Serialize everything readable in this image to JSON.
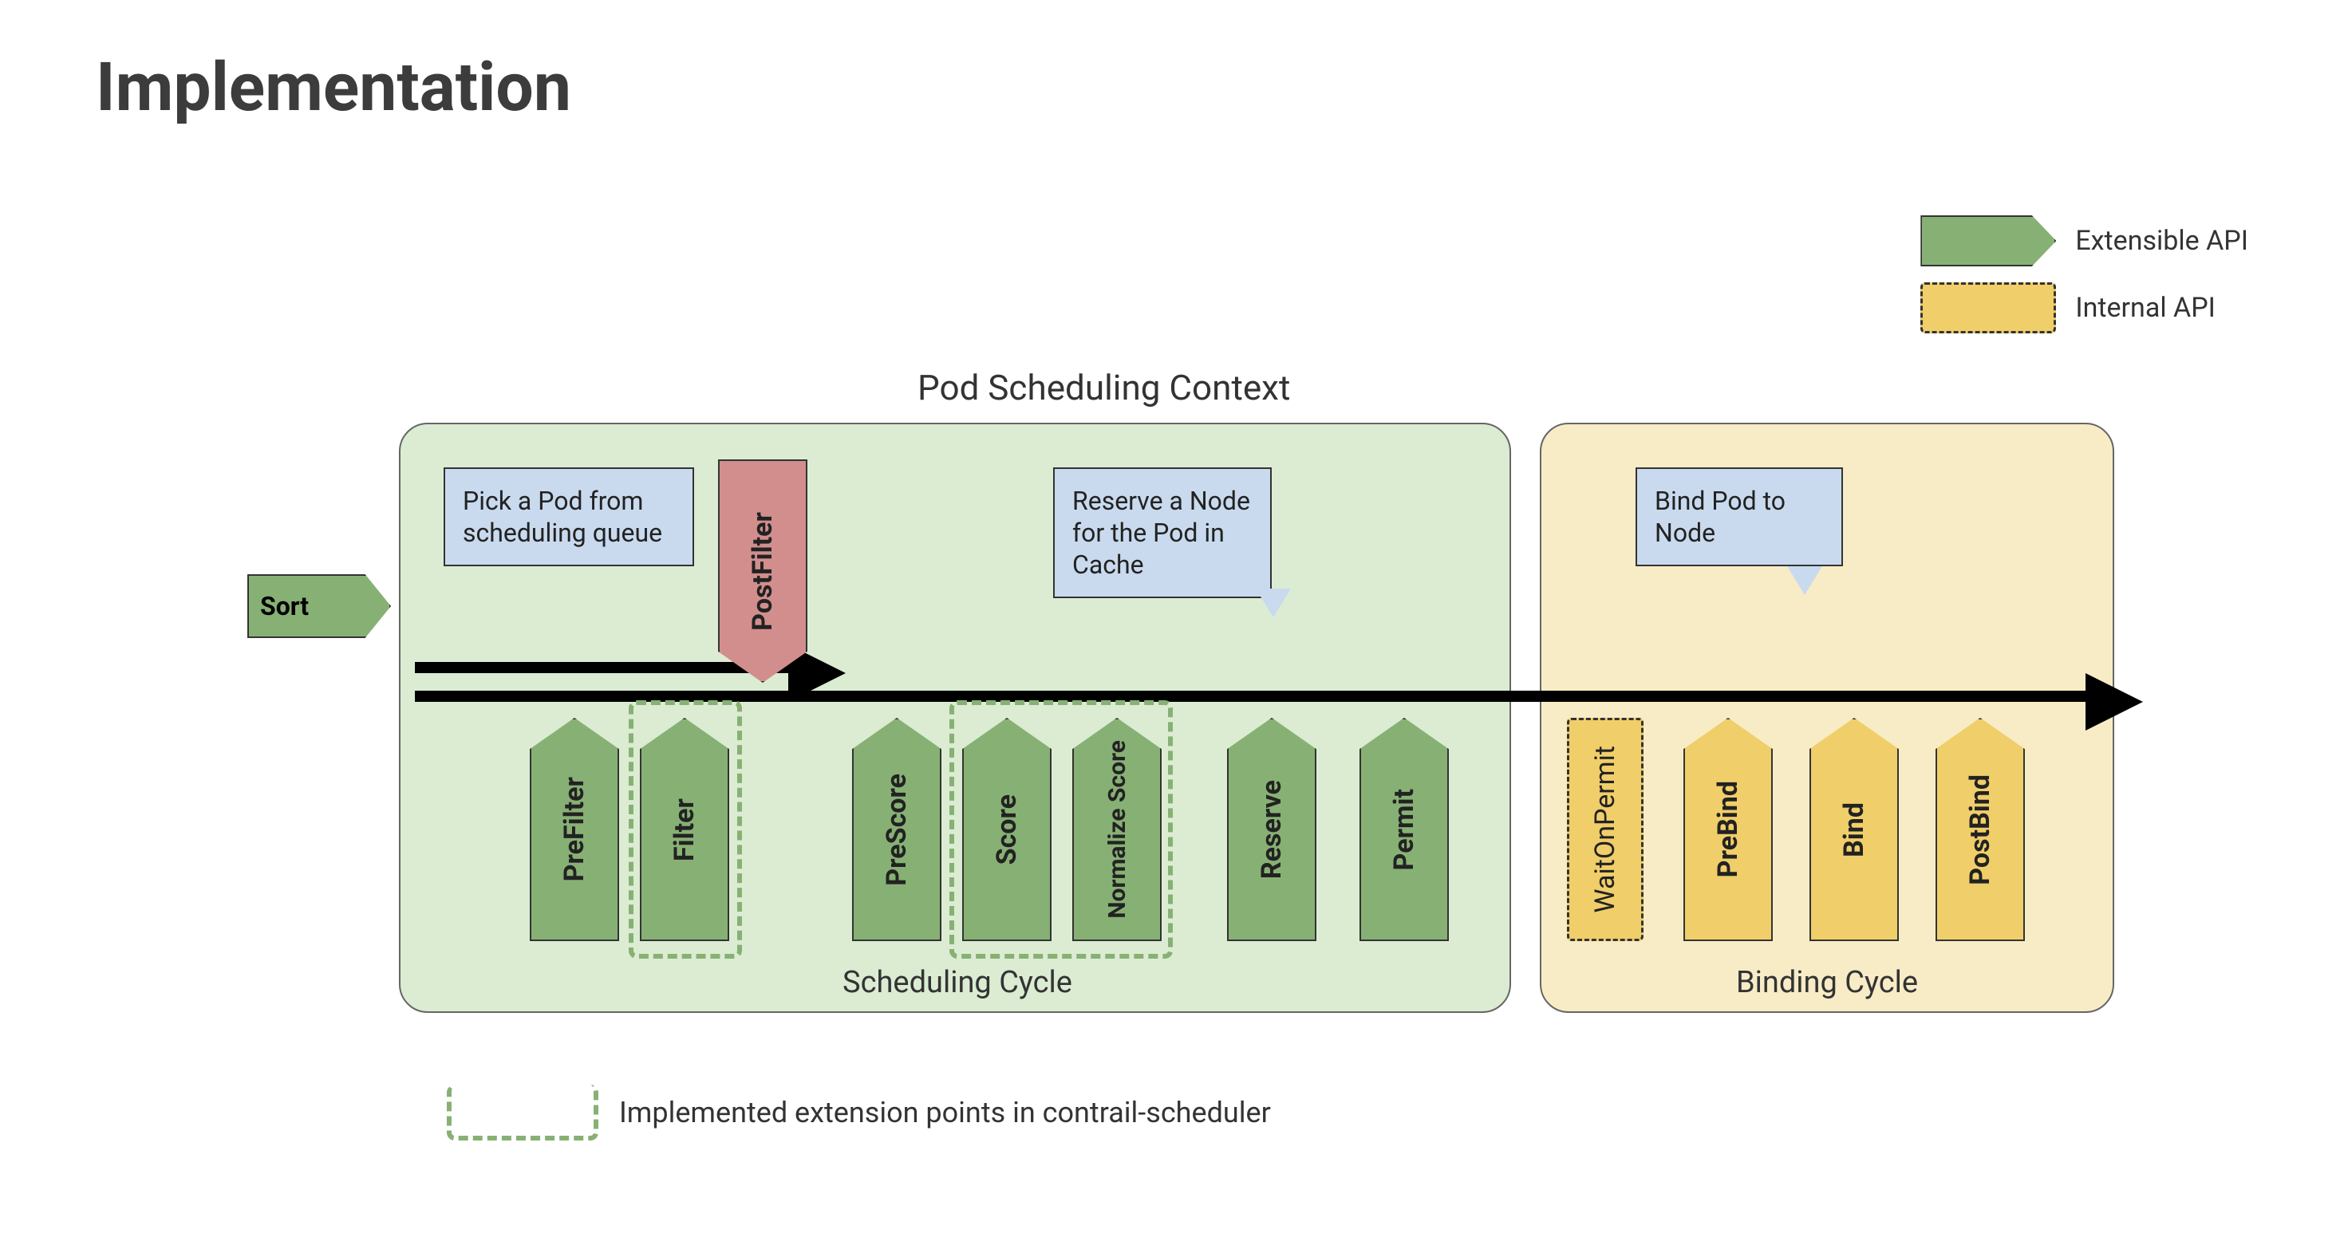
{
  "title": "Implementation",
  "legend": {
    "extensible": "Extensible API",
    "internal": "Internal API"
  },
  "context_title": "Pod Scheduling Context",
  "cycles": {
    "scheduling": "Scheduling Cycle",
    "binding": "Binding Cycle"
  },
  "sort_label": "Sort",
  "callouts": {
    "pick": "Pick a Pod from scheduling queue",
    "reserve": "Reserve a Node for the Pod in Cache",
    "bind": "Bind Pod to Node"
  },
  "extensions": {
    "post_filter": "PostFilter",
    "pre_filter": "PreFilter",
    "filter": "Filter",
    "pre_score": "PreScore",
    "score": "Score",
    "normalize_score": "Normalize Score",
    "reserve": "Reserve",
    "permit": "Permit",
    "wait_on_permit": "WaitOnPermit",
    "pre_bind": "PreBind",
    "bind": "Bind",
    "post_bind": "PostBind"
  },
  "note": "Implemented extension points in contrail-scheduler",
  "colors": {
    "green": "#87b174",
    "green_bg": "#dbecd3",
    "yellow": "#f0ce69",
    "yellow_bg": "#f8ecc6",
    "pink": "#d18e8d",
    "blue": "#c9daee"
  }
}
